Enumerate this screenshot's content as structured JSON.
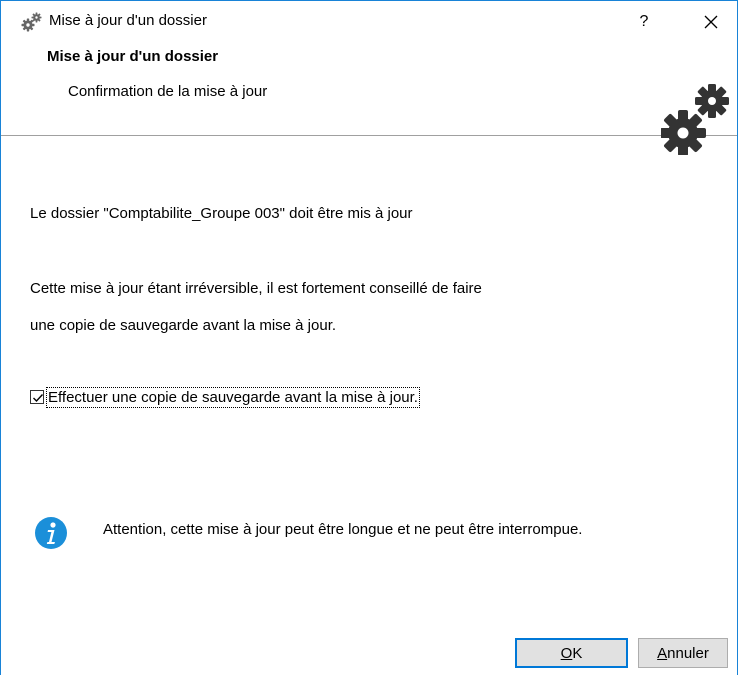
{
  "window": {
    "title": "Mise à jour d'un dossier",
    "help_label": "?",
    "icons": {
      "title": "gears-icon",
      "close": "close-icon"
    }
  },
  "header": {
    "title": "Mise à jour d'un dossier",
    "subtitle": "Confirmation de la mise à jour",
    "icon": "gears-icon"
  },
  "body": {
    "line1": "Le dossier \"Comptabilite_Groupe 003\" doit être mis à jour",
    "line2": "Cette mise à jour étant irréversible, il est fortement conseillé de faire",
    "line3": "une copie de sauvegarde avant la mise à jour.",
    "checkbox": {
      "label": "Effectuer une copie de sauvegarde avant la mise à jour.",
      "checked": true
    },
    "info": {
      "icon": "info-icon",
      "text": "Attention, cette mise à jour peut être longue et ne peut être interrompue."
    }
  },
  "buttons": {
    "ok": {
      "accel": "O",
      "rest": "K"
    },
    "cancel": {
      "accel": "A",
      "rest": "nnuler"
    }
  },
  "colors": {
    "accent": "#0078d7",
    "info_blue": "#1b8fd9",
    "window_border": "#1883d7"
  }
}
